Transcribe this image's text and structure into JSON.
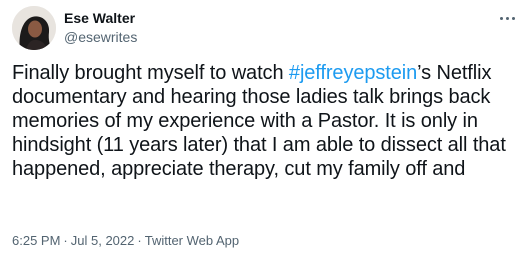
{
  "author": {
    "display_name": "Ese Walter",
    "handle": "@esewrites"
  },
  "tweet": {
    "text_before": "Finally brought myself to watch ",
    "hashtag": "#jeffreyepstein",
    "text_after": "’s Netflix documentary and hearing those ladies talk brings back memories of my experience with a Pastor. It is only in hindsight (11 years later) that I am able to dissect all that happened, appreciate therapy, cut my family off and",
    "hashtag_color": "#1d9bf0"
  },
  "meta": {
    "time": "6:25 PM",
    "date": "Jul 5, 2022",
    "separator": "·",
    "source": "Twitter Web App"
  },
  "icons": {
    "more": "more-options-icon",
    "avatar": "profile-photo"
  }
}
